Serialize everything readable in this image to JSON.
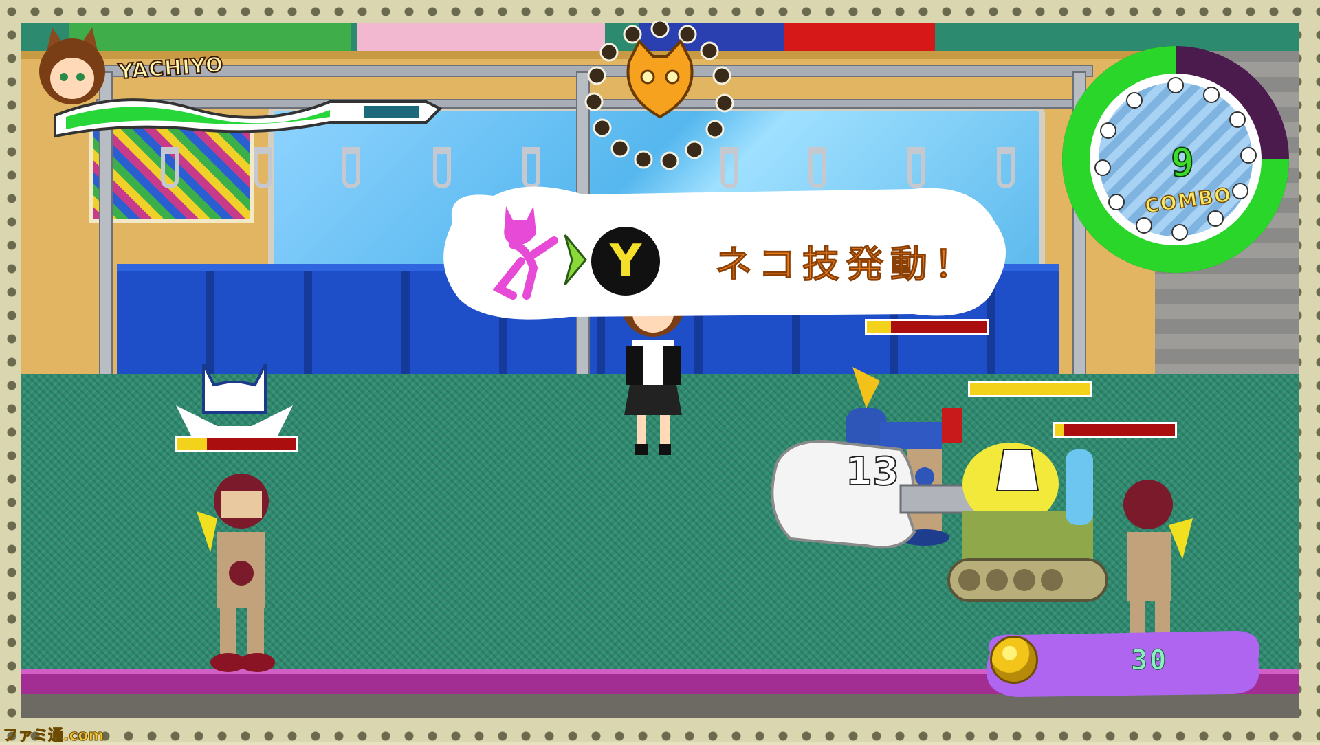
{
  "player": {
    "name": "YACHIYO",
    "hp_fraction": 0.82
  },
  "combo": {
    "count": "9",
    "label": "COMBO",
    "meter_fraction": 0.75
  },
  "prompt": {
    "button": "Y",
    "text": "ネコ技発動！"
  },
  "damage_popup": "13",
  "coins": "30",
  "enemies": [
    {
      "hp_fraction": 0.25
    },
    {
      "hp_fraction": 0.2
    },
    {
      "hp_fraction": 1.0
    },
    {
      "hp_fraction": 0.07
    }
  ],
  "colors": {
    "hp_green": "#27d73a",
    "combo_green": "#2ad62a",
    "combo_purple": "#4b1b4e",
    "prompt_orange": "#e87a1e",
    "enemy_hp_red": "#aa0e0e",
    "enemy_hp_yellow": "#f2d21a"
  },
  "watermark": "ファミ通.com",
  "icons": [
    "cat-head-icon",
    "cat-wreath-icon",
    "coin-icon",
    "y-button-icon",
    "chevron-right-icon",
    "pink-cat-icon"
  ]
}
